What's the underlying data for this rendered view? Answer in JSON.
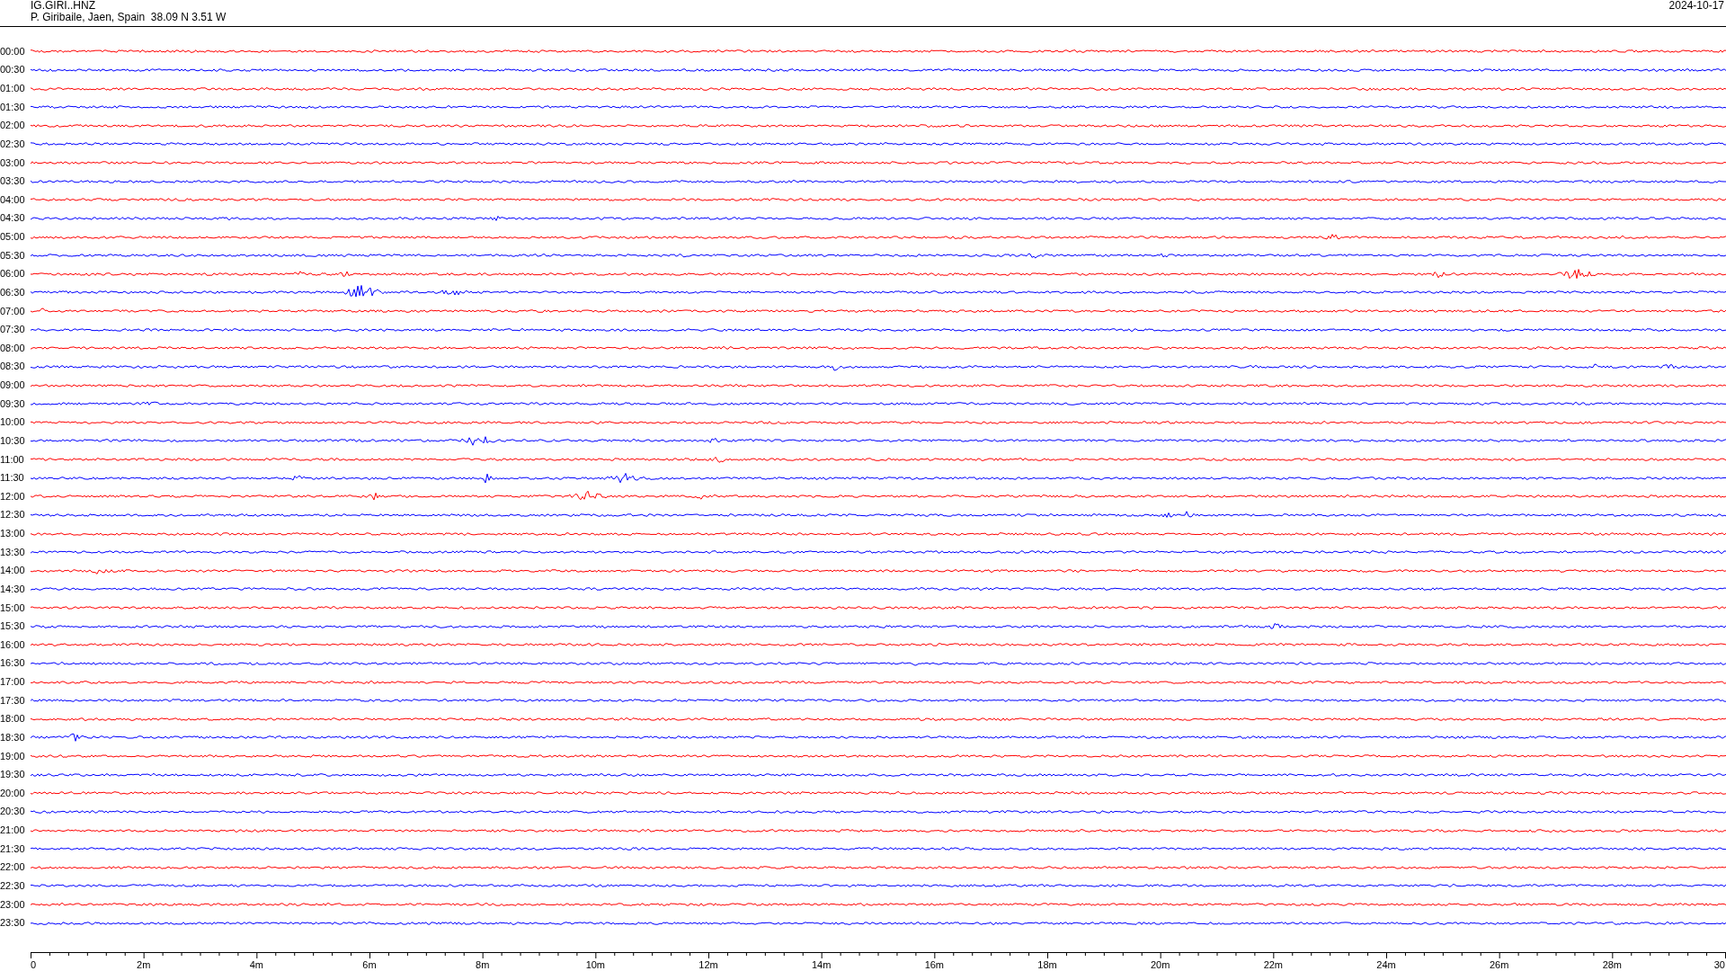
{
  "header": {
    "station": "IG.GIRI..HNZ",
    "location": "P. Giribaile, Jaen, Spain  38.09 N 3.51 W",
    "date": "2024-10-17"
  },
  "traces": [
    {
      "time": "00:00",
      "color": "#ff0000"
    },
    {
      "time": "00:30",
      "color": "#0000ff"
    },
    {
      "time": "01:00",
      "color": "#ff0000"
    },
    {
      "time": "01:30",
      "color": "#0000ff"
    },
    {
      "time": "02:00",
      "color": "#ff0000"
    },
    {
      "time": "02:30",
      "color": "#0000ff"
    },
    {
      "time": "03:00",
      "color": "#ff0000"
    },
    {
      "time": "03:30",
      "color": "#0000ff"
    },
    {
      "time": "04:00",
      "color": "#ff0000"
    },
    {
      "time": "04:30",
      "color": "#0000ff"
    },
    {
      "time": "05:00",
      "color": "#ff0000"
    },
    {
      "time": "05:30",
      "color": "#0000ff"
    },
    {
      "time": "06:00",
      "color": "#ff0000"
    },
    {
      "time": "06:30",
      "color": "#0000ff"
    },
    {
      "time": "07:00",
      "color": "#ff0000"
    },
    {
      "time": "07:30",
      "color": "#0000ff"
    },
    {
      "time": "08:00",
      "color": "#ff0000"
    },
    {
      "time": "08:30",
      "color": "#0000ff"
    },
    {
      "time": "09:00",
      "color": "#ff0000"
    },
    {
      "time": "09:30",
      "color": "#0000ff"
    },
    {
      "time": "10:00",
      "color": "#ff0000"
    },
    {
      "time": "10:30",
      "color": "#0000ff"
    },
    {
      "time": "11:00",
      "color": "#ff0000"
    },
    {
      "time": "11:30",
      "color": "#0000ff"
    },
    {
      "time": "12:00",
      "color": "#ff0000"
    },
    {
      "time": "12:30",
      "color": "#0000ff"
    },
    {
      "time": "13:00",
      "color": "#ff0000"
    },
    {
      "time": "13:30",
      "color": "#0000ff"
    },
    {
      "time": "14:00",
      "color": "#ff0000"
    },
    {
      "time": "14:30",
      "color": "#0000ff"
    },
    {
      "time": "15:00",
      "color": "#ff0000"
    },
    {
      "time": "15:30",
      "color": "#0000ff"
    },
    {
      "time": "16:00",
      "color": "#ff0000"
    },
    {
      "time": "16:30",
      "color": "#0000ff"
    },
    {
      "time": "17:00",
      "color": "#ff0000"
    },
    {
      "time": "17:30",
      "color": "#0000ff"
    },
    {
      "time": "18:00",
      "color": "#ff0000"
    },
    {
      "time": "18:30",
      "color": "#0000ff"
    },
    {
      "time": "19:00",
      "color": "#ff0000"
    },
    {
      "time": "19:30",
      "color": "#0000ff"
    },
    {
      "time": "20:00",
      "color": "#ff0000"
    },
    {
      "time": "20:30",
      "color": "#0000ff"
    },
    {
      "time": "21:00",
      "color": "#ff0000"
    },
    {
      "time": "21:30",
      "color": "#0000ff"
    },
    {
      "time": "22:00",
      "color": "#ff0000"
    },
    {
      "time": "22:30",
      "color": "#0000ff"
    },
    {
      "time": "23:00",
      "color": "#ff0000"
    },
    {
      "time": "23:30",
      "color": "#0000ff"
    }
  ],
  "axis": {
    "tick_labels": [
      "0",
      "2m",
      "4m",
      "6m",
      "8m",
      "10m",
      "12m",
      "14m",
      "16m",
      "18m",
      "20m",
      "22m",
      "24m",
      "26m",
      "28m",
      "30"
    ]
  }
}
